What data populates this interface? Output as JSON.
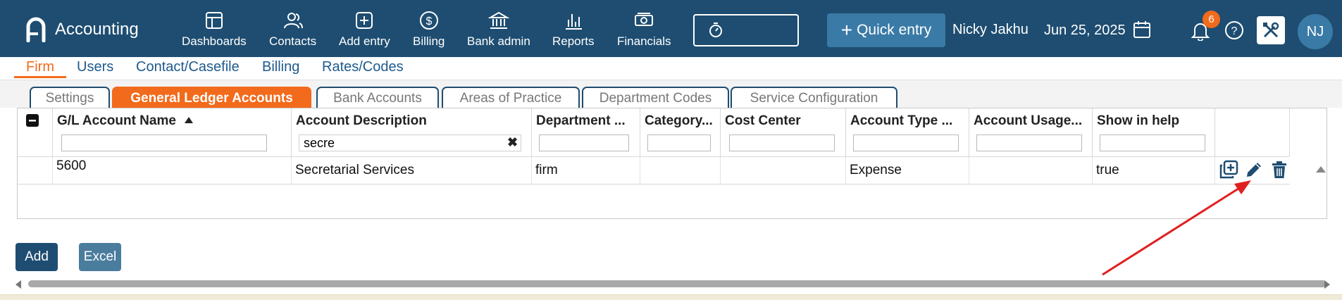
{
  "app": {
    "title": "Accounting",
    "logo_icon": "app-logo-icon"
  },
  "nav": [
    {
      "label": "Dashboards",
      "icon": "dashboard-icon"
    },
    {
      "label": "Contacts",
      "icon": "contacts-icon"
    },
    {
      "label": "Add entry",
      "icon": "add-entry-icon"
    },
    {
      "label": "Billing",
      "icon": "billing-dollar-icon"
    },
    {
      "label": "Bank admin",
      "icon": "bank-icon"
    },
    {
      "label": "Reports",
      "icon": "reports-chart-icon"
    },
    {
      "label": "Financials",
      "icon": "financials-icon"
    }
  ],
  "header": {
    "timer_icon": "timer-icon",
    "quick_entry_label": "Quick entry",
    "user_name": "Nicky Jakhu",
    "date": "Jun 25, 2025",
    "notification_count": "6",
    "avatar_initials": "NJ"
  },
  "subnav": [
    {
      "label": "Firm",
      "active": true
    },
    {
      "label": "Users"
    },
    {
      "label": "Contact/Casefile"
    },
    {
      "label": "Billing"
    },
    {
      "label": "Rates/Codes"
    }
  ],
  "tabs": [
    {
      "label": "Settings"
    },
    {
      "label": "General Ledger Accounts",
      "active": true
    },
    {
      "label": "Bank Accounts"
    },
    {
      "label": "Areas of Practice"
    },
    {
      "label": "Department Codes"
    },
    {
      "label": "Service Configuration"
    }
  ],
  "grid": {
    "columns": [
      {
        "label": "G/L Account Name",
        "sorted": "asc",
        "filter": ""
      },
      {
        "label": "Account Description",
        "filter": "secre"
      },
      {
        "label": "Department ...",
        "filter": ""
      },
      {
        "label": "Category...",
        "filter": ""
      },
      {
        "label": "Cost Center",
        "filter": ""
      },
      {
        "label": "Account Type ...",
        "filter": ""
      },
      {
        "label": "Account Usage...",
        "filter": ""
      },
      {
        "label": "Show in help",
        "filter": ""
      }
    ],
    "rows": [
      {
        "cells": [
          "5600",
          "Secretarial Services",
          "firm",
          "",
          "",
          "Expense",
          "",
          "true"
        ]
      }
    ]
  },
  "buttons": {
    "add": "Add",
    "excel": "Excel"
  },
  "colors": {
    "header_bg": "#1e4d71",
    "accent": "#f26a1b",
    "link": "#1e5a8c",
    "annotation_arrow": "#e02020"
  }
}
